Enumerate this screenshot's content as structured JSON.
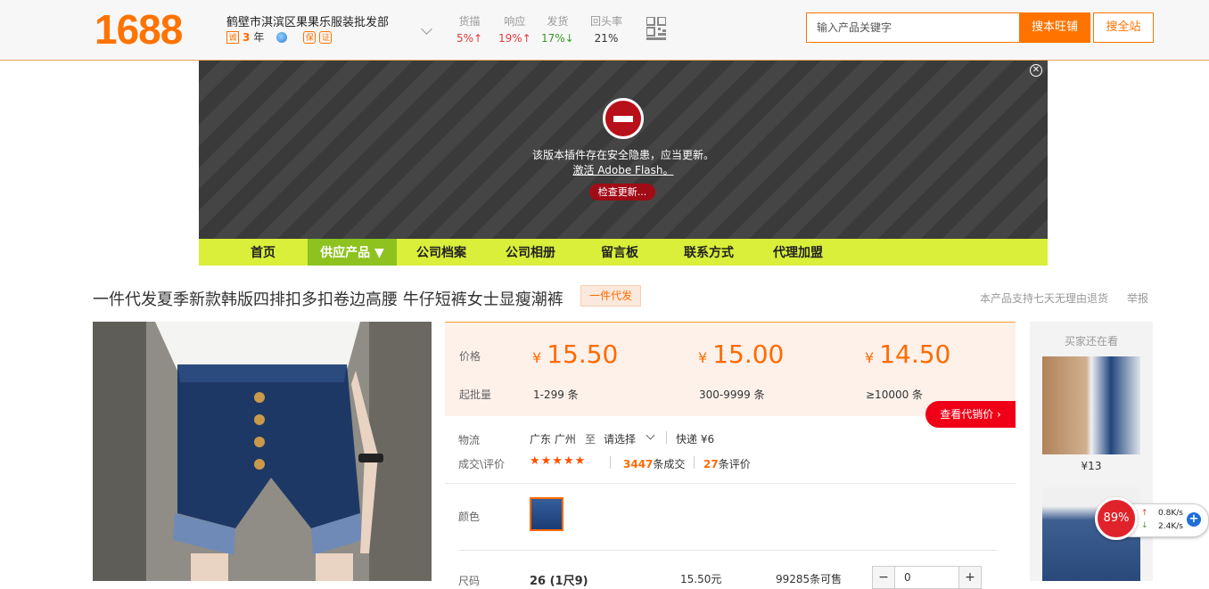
{
  "header": {
    "logo": "1688",
    "company_name": "鹤壁市淇滨区果果乐服装批发部",
    "years_value": "3",
    "years_unit": "年",
    "stats": [
      {
        "label": "货描",
        "value": "5%↑",
        "color": "#e4393c"
      },
      {
        "label": "响应",
        "value": "19%↑",
        "color": "#e4393c"
      },
      {
        "label": "发货",
        "value": "17%↓",
        "color": "#3a9a2a"
      },
      {
        "label": "回头率",
        "value": "21%",
        "color": "#333333"
      }
    ],
    "search_placeholder": "输入产品关键字",
    "search_shop_label": "搜本旺铺",
    "search_all_label": "搜全站"
  },
  "flash": {
    "message": "该版本插件存在安全隐患，应当更新。",
    "link": "激活 Adobe Flash。",
    "button": "检查更新..."
  },
  "nav": [
    {
      "label": "首页",
      "active": false
    },
    {
      "label": "供应产品 ▼",
      "active": true
    },
    {
      "label": "公司档案",
      "active": false
    },
    {
      "label": "公司相册",
      "active": false
    },
    {
      "label": "留言板",
      "active": false
    },
    {
      "label": "联系方式",
      "active": false
    },
    {
      "label": "代理加盟",
      "active": false
    }
  ],
  "product": {
    "title": "一件代发夏季新款韩版四排扣多扣卷边高腰 牛仔短裤女士显瘦潮裤",
    "tag": "一件代发",
    "return_note": "本产品支持七天无理由退货",
    "report": "举报"
  },
  "pricing": {
    "price_label": "价格",
    "moq_label": "起批量",
    "currency": "¥",
    "tiers": [
      {
        "price": "15.50",
        "qty": "1-299 条"
      },
      {
        "price": "15.00",
        "qty": "300-9999 条"
      },
      {
        "price": "14.50",
        "qty": "≥10000 条"
      }
    ],
    "agent_price_button": "查看代销价 ›"
  },
  "logistics": {
    "label": "物流",
    "origin": "广东 广州",
    "to": "至",
    "select": "请选择",
    "express": "快递 ¥6"
  },
  "reviews": {
    "label": "成交\\评价",
    "stars": "★★★★★",
    "deals_count": "3447",
    "deals_text": "条成交",
    "reviews_count": "27",
    "reviews_text": "条评价"
  },
  "color": {
    "label": "颜色"
  },
  "size_row": {
    "label": "尺码",
    "value": "26 (1尺9)",
    "price": "15.50元",
    "stock": "99285条可售",
    "quantity": "0",
    "minus": "−",
    "plus": "+"
  },
  "also_viewed": {
    "title": "买家还在看",
    "price": "¥13"
  },
  "net_widget": {
    "percent": "89%",
    "up": "0.8K/s",
    "down": "2.4K/s"
  }
}
